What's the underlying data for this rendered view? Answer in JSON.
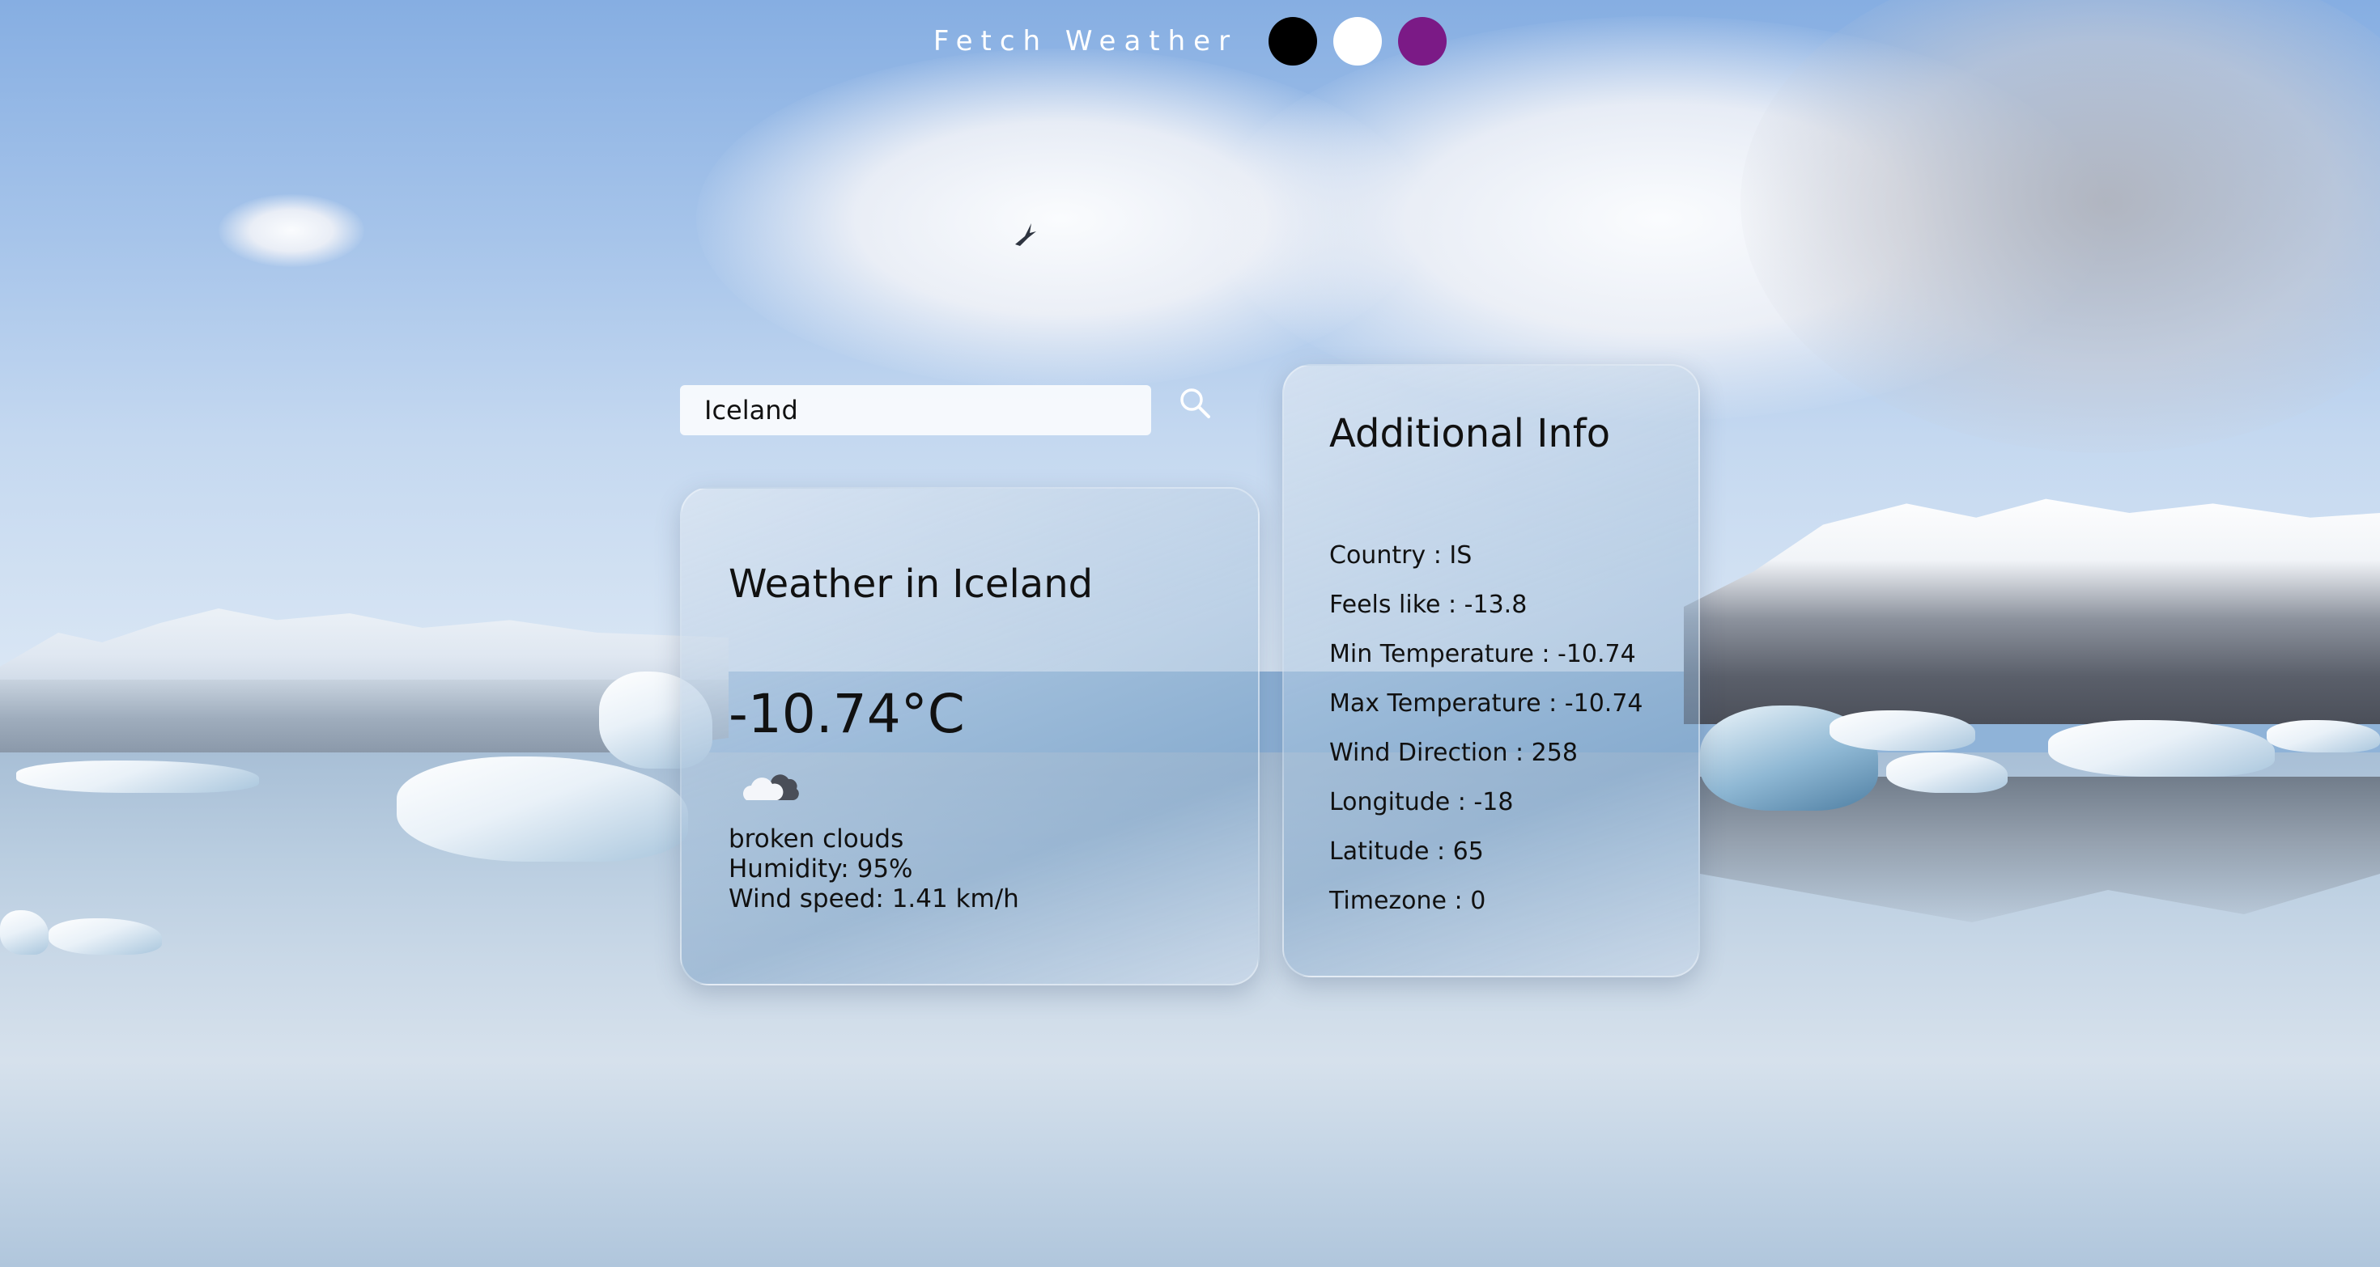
{
  "header": {
    "title": "Fetch Weather",
    "themes": [
      {
        "name": "black",
        "color": "#000000"
      },
      {
        "name": "white",
        "color": "#ffffff"
      },
      {
        "name": "purple",
        "color": "#7b1a86"
      }
    ]
  },
  "search": {
    "value": "Iceland",
    "button_icon": "search-icon"
  },
  "weather": {
    "title": "Weather in Iceland",
    "temperature": "-10.74°C",
    "icon": "broken-clouds-icon",
    "description": "broken clouds",
    "humidity": "Humidity: 95%",
    "wind_speed": "Wind speed: 1.41 km/h"
  },
  "additional_info": {
    "title": "Additional Info",
    "items": [
      {
        "label": "Country",
        "value": "IS"
      },
      {
        "label": "Feels like",
        "value": "-13.8"
      },
      {
        "label": "Min Temperature",
        "value": "-10.74"
      },
      {
        "label": "Max Temperature",
        "value": "-10.74"
      },
      {
        "label": "Wind Direction",
        "value": "258"
      },
      {
        "label": "Longitude",
        "value": "-18"
      },
      {
        "label": "Latitude",
        "value": "65"
      },
      {
        "label": "Timezone",
        "value": "0"
      }
    ]
  }
}
